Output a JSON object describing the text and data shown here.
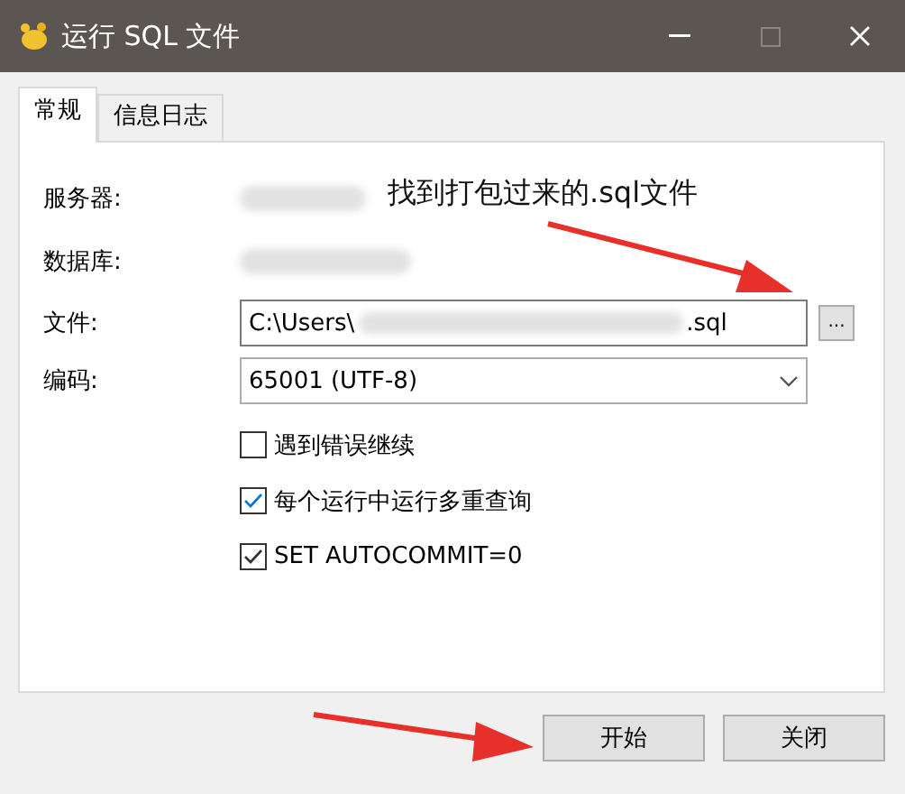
{
  "window": {
    "title": "运行 SQL 文件"
  },
  "tabs": [
    {
      "label": "常规",
      "selected": true
    },
    {
      "label": "信息日志",
      "selected": false
    }
  ],
  "fields": [
    {
      "kind": "info",
      "label": "服务器:"
    },
    {
      "kind": "info",
      "label": "数据库:"
    },
    {
      "kind": "file",
      "label": "文件:",
      "value_start": "C:\\Users\\",
      "value_end": ".sql",
      "browse": "..."
    },
    {
      "kind": "select",
      "label": "编码:",
      "value": "65001 (UTF-8)"
    }
  ],
  "options": [
    {
      "label": "遇到错误继续",
      "checked": false
    },
    {
      "label": "每个运行中运行多重查询",
      "checked": true
    },
    {
      "label": "SET AUTOCOMMIT=0",
      "checked": true
    }
  ],
  "annotation": {
    "text": "找到打包过来的.sql文件"
  },
  "buttons": [
    {
      "label": "开始"
    },
    {
      "label": "关闭"
    }
  ]
}
